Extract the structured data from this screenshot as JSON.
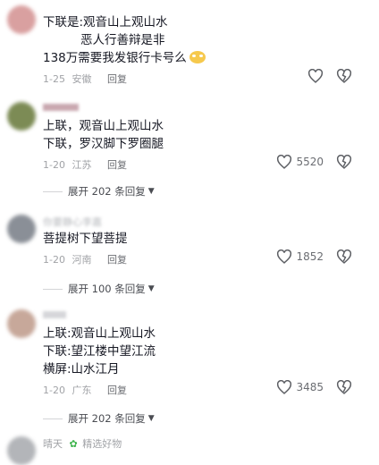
{
  "comments": [
    {
      "lines": [
        "下联是:观音山上观山水",
        "恶人行善辩是非",
        "138万需要我发银行卡号么"
      ],
      "date": "1-25",
      "region": "安徽",
      "reply_label": "回复",
      "likes": ""
    },
    {
      "lines": [
        "上联，观音山上观山水",
        "下联，罗汉脚下罗圈腿"
      ],
      "date": "1-20",
      "region": "江苏",
      "reply_label": "回复",
      "likes": "5520",
      "expand": "展开 202 条回复"
    },
    {
      "username": "你要静心李嘉",
      "lines": [
        "菩提树下望菩提"
      ],
      "date": "1-20",
      "region": "河南",
      "reply_label": "回复",
      "likes": "1852",
      "expand": "展开 100 条回复"
    },
    {
      "lines": [
        "上联:观音山上观山水",
        "下联:望江楼中望江流",
        "横屏:山水江月"
      ],
      "date": "1-20",
      "region": "广东",
      "reply_label": "回复",
      "likes": "3485",
      "expand": "展开 202 条回复"
    },
    {
      "username": "晴天",
      "badge": "精选好物"
    }
  ],
  "icons": {
    "like": "heart-outline-icon",
    "dislike": "broken-heart-icon",
    "expand": "chevron-down-icon",
    "emoji": "grin-emoji-icon"
  },
  "colors": {
    "text": "#161823",
    "meta": "#a1a3a7",
    "background": "#ffffff"
  }
}
